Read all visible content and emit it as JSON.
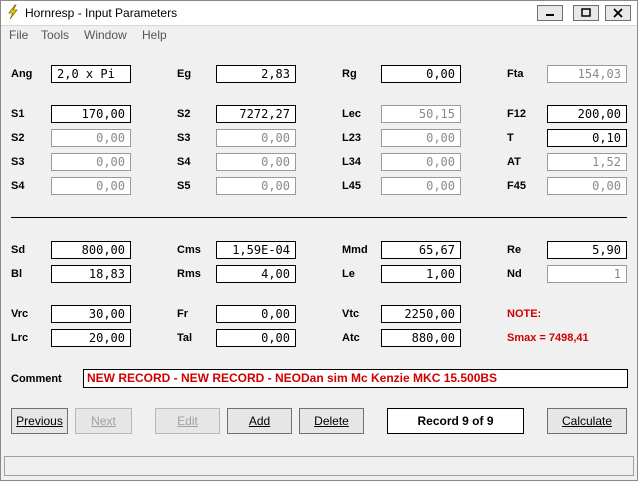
{
  "window": {
    "title": "Hornresp - Input Parameters"
  },
  "menu": [
    "File",
    "Tools",
    "Window",
    "Help"
  ],
  "params": {
    "Ang": {
      "label": "Ang",
      "value": "2,0 x Pi"
    },
    "Eg": {
      "label": "Eg",
      "value": "2,83"
    },
    "Rg": {
      "label": "Rg",
      "value": "0,00"
    },
    "Fta": {
      "label": "Fta",
      "value": "154,03"
    },
    "S1": {
      "label": "S1",
      "value": "170,00"
    },
    "S2a": {
      "label": "S2",
      "value": "7272,27"
    },
    "Lec": {
      "label": "Lec",
      "value": "50,15"
    },
    "F12": {
      "label": "F12",
      "value": "200,00"
    },
    "S2b": {
      "label": "S2",
      "value": "0,00"
    },
    "S3a": {
      "label": "S3",
      "value": "0,00"
    },
    "L23": {
      "label": "L23",
      "value": "0,00"
    },
    "T": {
      "label": "T",
      "value": "0,10"
    },
    "S3b": {
      "label": "S3",
      "value": "0,00"
    },
    "S4a": {
      "label": "S4",
      "value": "0,00"
    },
    "L34": {
      "label": "L34",
      "value": "0,00"
    },
    "AT": {
      "label": "AT",
      "value": "1,52"
    },
    "S4b": {
      "label": "S4",
      "value": "0,00"
    },
    "S5": {
      "label": "S5",
      "value": "0,00"
    },
    "L45": {
      "label": "L45",
      "value": "0,00"
    },
    "F45": {
      "label": "F45",
      "value": "0,00"
    },
    "Sd": {
      "label": "Sd",
      "value": "800,00"
    },
    "Cms": {
      "label": "Cms",
      "value": "1,59E-04"
    },
    "Mmd": {
      "label": "Mmd",
      "value": "65,67"
    },
    "Re": {
      "label": "Re",
      "value": "5,90"
    },
    "Bl": {
      "label": "Bl",
      "value": "18,83"
    },
    "Rms": {
      "label": "Rms",
      "value": "4,00"
    },
    "Le": {
      "label": "Le",
      "value": "1,00"
    },
    "Nd": {
      "label": "Nd",
      "value": "1"
    },
    "Vrc": {
      "label": "Vrc",
      "value": "30,00"
    },
    "Fr": {
      "label": "Fr",
      "value": "0,00"
    },
    "Vtc": {
      "label": "Vtc",
      "value": "2250,00"
    },
    "Lrc": {
      "label": "Lrc",
      "value": "20,00"
    },
    "Tal": {
      "label": "Tal",
      "value": "0,00"
    },
    "Atc": {
      "label": "Atc",
      "value": "880,00"
    }
  },
  "note": {
    "label": "NOTE:",
    "smax": "Smax = 7498,41"
  },
  "comment": {
    "label": "Comment",
    "value": "NEW RECORD - NEW RECORD - NEODan sim Mc Kenzie MKC 15.500BS"
  },
  "buttons": {
    "previous": "Previous",
    "next": "Next",
    "edit": "Edit",
    "add": "Add",
    "delete": "Delete",
    "calculate": "Calculate"
  },
  "record": "Record 9 of 9",
  "colors": {
    "note": "#d00000",
    "disabled": "#8a8a8a"
  }
}
